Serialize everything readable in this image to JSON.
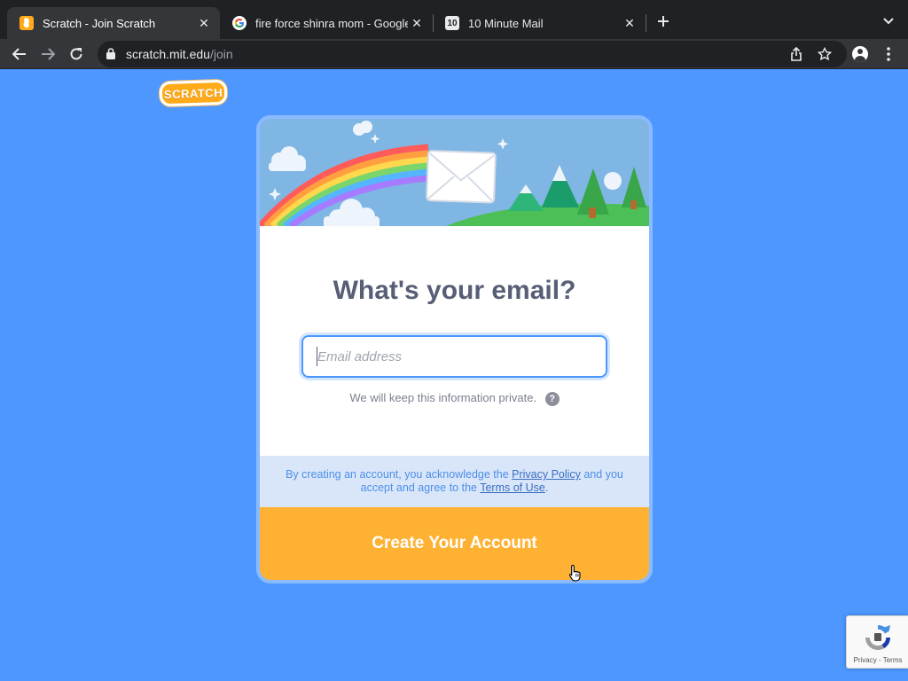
{
  "browser": {
    "tabs": [
      {
        "title": "Scratch - Join Scratch",
        "active": true,
        "icon": "scratch-favicon"
      },
      {
        "title": "fire force shinra mom - Google",
        "active": false,
        "icon": "google-icon"
      },
      {
        "title": "10 Minute Mail",
        "active": false,
        "icon": "10minutemail-favicon",
        "favicon_text": "10"
      }
    ],
    "url_host": "scratch.mit.edu",
    "url_path": "/join"
  },
  "logo": {
    "text": "SCRATCH"
  },
  "modal": {
    "heading": "What's your email?",
    "email_placeholder": "Email address",
    "email_value": "",
    "privacy_note": "We will keep this information private.",
    "help_icon": "?",
    "legal_prefix": "By creating an account, you acknowledge the ",
    "privacy_link": "Privacy Policy",
    "legal_middle": " and you accept and agree to the ",
    "terms_link": "Terms of Use",
    "legal_suffix": ".",
    "create_button": "Create Your Account"
  },
  "recaptcha": {
    "links": "Privacy - Terms"
  },
  "colors": {
    "background": "#4d97ff",
    "button": "#ffb133",
    "heading": "#575e75",
    "legal_bg": "#d9e6fa"
  }
}
